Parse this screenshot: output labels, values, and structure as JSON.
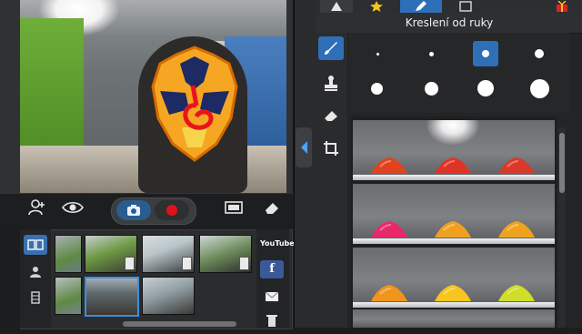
{
  "panel": {
    "title": "Kreslení od ruky"
  },
  "right_tabs": [
    {
      "icon": "wizard-hat-icon"
    },
    {
      "icon": "star-icon"
    },
    {
      "icon": "pencil-icon",
      "selected": true
    },
    {
      "icon": "frame-icon"
    },
    {
      "icon": "gift-icon"
    }
  ],
  "side_tools": [
    {
      "icon": "brush-icon",
      "selected": true
    },
    {
      "icon": "stamp-icon"
    },
    {
      "icon": "eraser-icon"
    },
    {
      "icon": "crop-icon"
    }
  ],
  "brush_sizes": {
    "count": 8,
    "selected_index": 2
  },
  "shelves": [
    {
      "piles": [
        "#e2431f",
        "#e03327",
        "#d9382a"
      ]
    },
    {
      "piles": [
        "#e9286a",
        "#f0a020",
        "#f1a21c"
      ]
    },
    {
      "piles": [
        "#f0941c",
        "#f6c51e",
        "#cfdd2b"
      ]
    }
  ],
  "camera_toolbar": {
    "icons": [
      "add-person-icon",
      "eye-icon",
      "camera-icon",
      "record-icon",
      "screen-icon",
      "eraser-icon"
    ]
  },
  "share": {
    "youtube_label": "YouTube",
    "facebook_label": "f"
  },
  "colors": {
    "accent": "#2f6fb8",
    "record": "#e0131a",
    "facebook": "#3b5998"
  }
}
